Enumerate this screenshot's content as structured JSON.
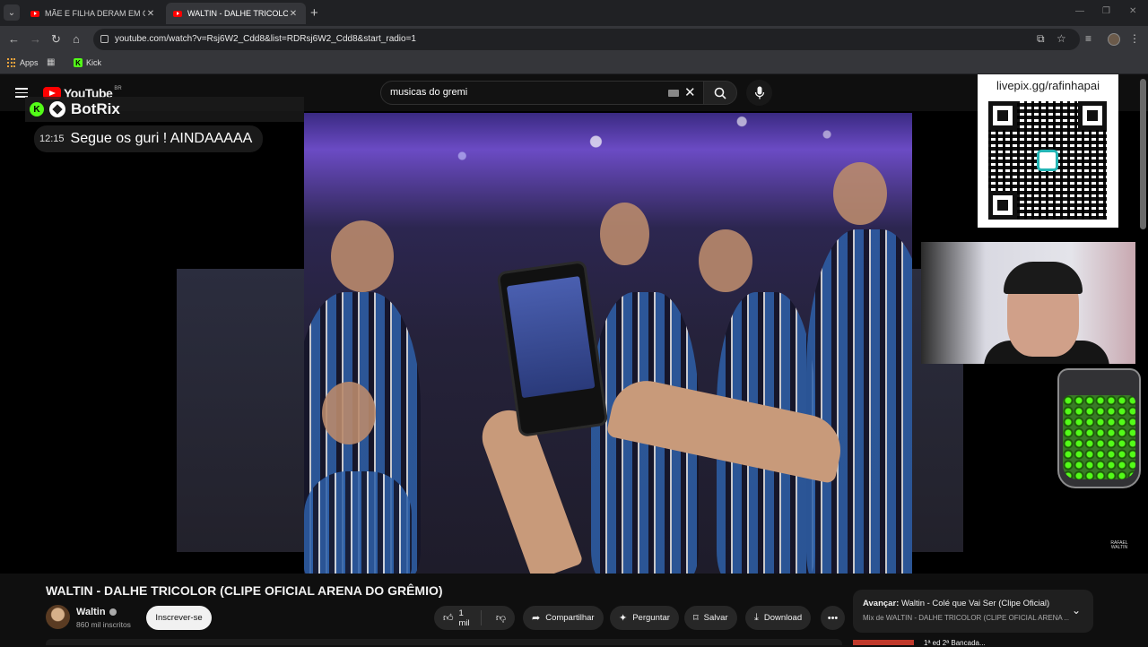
{
  "browser": {
    "tabs": [
      {
        "title": "MÃE E FILHA DERAM EM CIMA",
        "active": false
      },
      {
        "title": "WALTIN - DALHE TRICOLOR (CL",
        "active": true
      }
    ],
    "url": "youtube.com/watch?v=Rsj6W2_Cdd8&list=RDRsj6W2_Cdd8&start_radio=1",
    "bookmarks": [
      {
        "label": "Apps",
        "icon": "apps-grid-icon"
      },
      {
        "label": "Kick",
        "icon": "kick-icon"
      }
    ]
  },
  "youtube": {
    "logo_text": "YouTube",
    "region": "BR",
    "search_value": "musicas do gremi"
  },
  "overlay": {
    "botrix_name": "BotRix",
    "chat_time": "12:15",
    "chat_message": "Segue os guri ! AINDAAAAA",
    "qr_label": "livepix.gg/rafinhapai",
    "watermark": "RAFAEL WALTIN",
    "kick_colour": "#53fc18"
  },
  "video": {
    "title": "WALTIN - DALHE TRICOLOR (CLIPE OFICIAL ARENA DO GRÊMIO)",
    "channel": "Waltin",
    "subscribers": "860 mil inscritos",
    "subscribe_label": "Inscrever-se",
    "likes": "1 mil",
    "share_label": "Compartilhar",
    "ask_label": "Perguntar",
    "save_label": "Salvar",
    "download_label": "Download"
  },
  "up_next": {
    "prefix": "Avançar:",
    "title": "Waltin - Colé que Vai Ser (Clipe Oficial)",
    "subtitle": "Mix de WALTIN - DALHE TRICOLOR (CLIPE OFICIAL ARENA ...",
    "next_item": "1ª ed 2ª Bancada..."
  },
  "colors": {
    "bg": "#0f0f0f",
    "yt_red": "#ff0000",
    "pill": "#272727"
  }
}
